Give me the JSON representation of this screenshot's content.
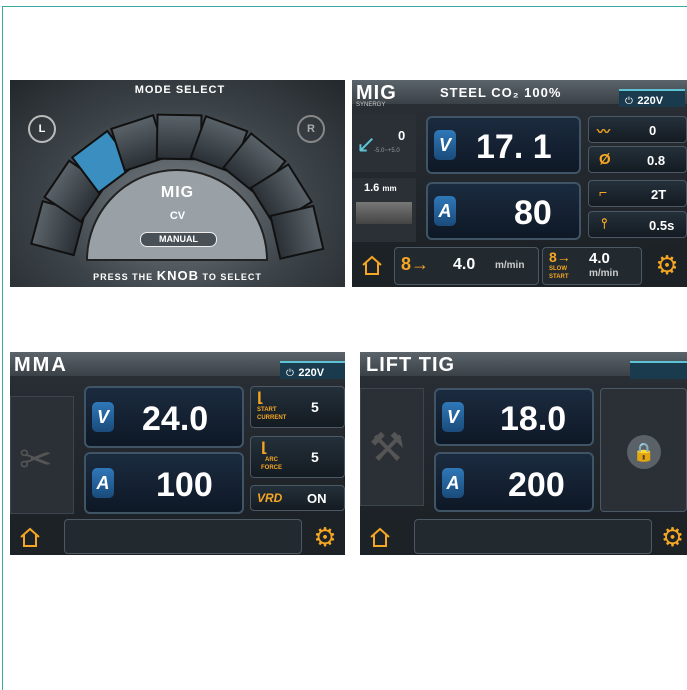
{
  "mode_select": {
    "title": "MODE SELECT",
    "left_knob": "L",
    "right_knob": "R",
    "mode": "MIG",
    "submode": "CV",
    "manual": "MANUAL",
    "footer_a": "PRESS THE",
    "footer_b": "KNOB",
    "footer_c": "TO SELECT"
  },
  "mig": {
    "title": "MIG",
    "subtitle": "SYNERGY",
    "material": "STEEL CO₂ 100%",
    "voltage": "220V",
    "voltage_value": "17. 1",
    "current_value": "80",
    "trim_value": "0",
    "trim_range": "-5.0~+5.0",
    "thickness": "1.6",
    "thickness_unit": "mm",
    "inductance": "0",
    "wire_dia": "0.8",
    "trigger": "2T",
    "burnback": "0.5s",
    "wire_speed": "4.0",
    "wire_unit": "m/min",
    "slow_label_a": "SLOW",
    "slow_label_b": "START",
    "slow_value": "4.0",
    "slow_unit": "m/min",
    "v_badge": "V",
    "a_badge": "A"
  },
  "mma": {
    "title": "MMA",
    "voltage": "220V",
    "voltage_value": "24.0",
    "current_value": "100",
    "start_current_label_a": "START",
    "start_current_label_b": "CURRENT",
    "start_current_value": "5",
    "arc_force_label_a": "ARC",
    "arc_force_label_b": "FORCE",
    "arc_force_value": "5",
    "vrd_label": "VRD",
    "vrd_value": "ON",
    "v_badge": "V",
    "a_badge": "A"
  },
  "tig": {
    "title": "LIFT TIG",
    "voltage_value": "18.0",
    "current_value": "200",
    "v_badge": "V",
    "a_badge": "A"
  }
}
